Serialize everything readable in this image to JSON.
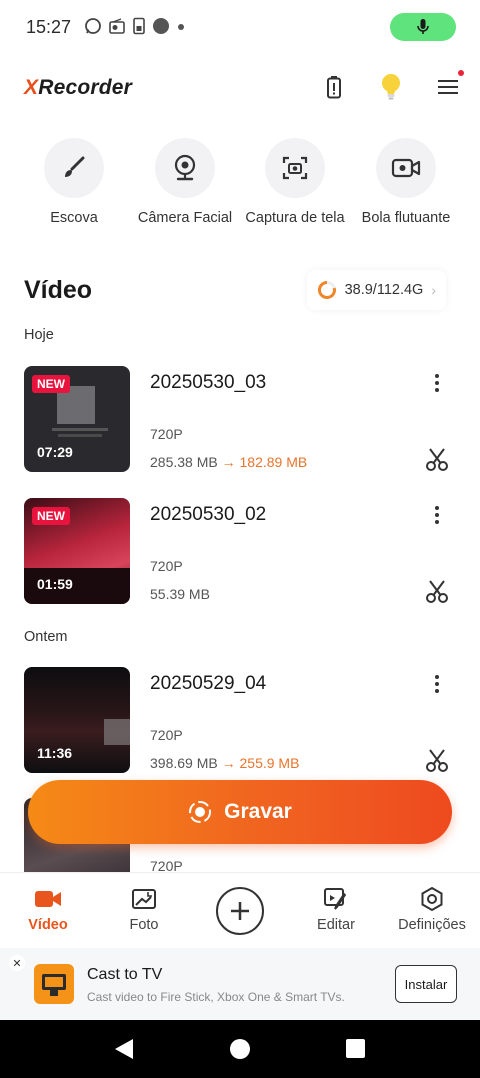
{
  "status_bar": {
    "time": "15:27",
    "icons": [
      "whatsapp-icon",
      "radio-icon",
      "sim-icon",
      "circle-icon",
      "dot-icon"
    ]
  },
  "app": {
    "logo_x": "X",
    "logo_rest": "Recorder"
  },
  "tools": [
    {
      "label": "Escova",
      "icon": "brush-icon"
    },
    {
      "label": "Câmera Facial",
      "icon": "webcam-icon"
    },
    {
      "label": "Captura de tela",
      "icon": "screenshot-icon"
    },
    {
      "label": "Bola flutuante",
      "icon": "floating-ball-icon"
    }
  ],
  "section": {
    "title": "Vídeo",
    "storage": "38.9/112.4G"
  },
  "groups": {
    "today": "Hoje",
    "yesterday": "Ontem"
  },
  "videos": [
    {
      "name": "20250530_03",
      "badge": "NEW",
      "duration": "07:29",
      "resolution": "720P",
      "size": "285.38 MB",
      "arrow": "→",
      "compressed": "182.89 MB"
    },
    {
      "name": "20250530_02",
      "badge": "NEW",
      "duration": "01:59",
      "resolution": "720P",
      "size": "55.39 MB"
    },
    {
      "name": "20250529_04",
      "duration": "11:36",
      "resolution": "720P",
      "size": "398.69 MB",
      "arrow": "→",
      "compressed": "255.9 MB"
    },
    {
      "resolution": "720P"
    }
  ],
  "record_button": {
    "label": "Gravar"
  },
  "bottom_nav": [
    {
      "label": "Vídeo",
      "active": true
    },
    {
      "label": "Foto"
    },
    {
      "label": "Editar"
    },
    {
      "label": "Definições"
    }
  ],
  "ad": {
    "close": "✕",
    "title": "Cast to TV",
    "description": "Cast video to Fire Stick, Xbox One & Smart TVs.",
    "install": "Instalar"
  },
  "colors": {
    "accent": "#e9561d",
    "badge": "#e9143d",
    "mic": "#5fe37d",
    "compressed": "#e9742b"
  }
}
